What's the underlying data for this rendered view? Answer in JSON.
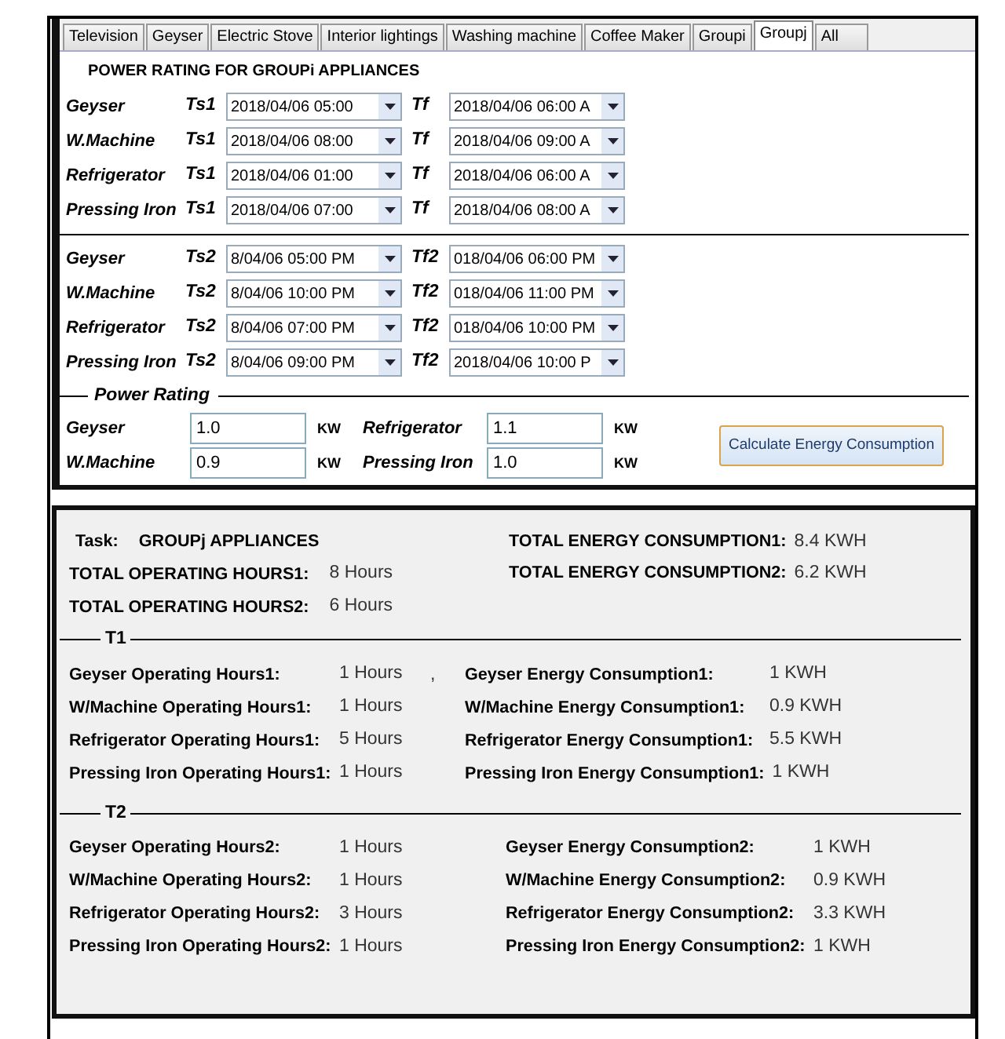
{
  "tabs": [
    {
      "label": "Television",
      "selected": false
    },
    {
      "label": "Geyser",
      "selected": false
    },
    {
      "label": "Electric Stove",
      "selected": false
    },
    {
      "label": "Interior lightings",
      "selected": false
    },
    {
      "label": "Washing machine",
      "selected": false
    },
    {
      "label": "Coffee Maker",
      "selected": false
    },
    {
      "label": "Groupi",
      "selected": false
    },
    {
      "label": "Groupj",
      "selected": true
    },
    {
      "label": "All",
      "selected": false
    }
  ],
  "section_title": "POWER RATING FOR GROUPi APPLIANCES",
  "schedule1": [
    {
      "appliance": "Geyser",
      "start_label": "Ts1",
      "start_value": "2018/04/06 05:00",
      "end_label": "Tf",
      "end_value": "2018/04/06 06:00 A"
    },
    {
      "appliance": "W.Machine",
      "start_label": "Ts1",
      "start_value": "2018/04/06 08:00",
      "end_label": "Tf",
      "end_value": "2018/04/06 09:00 A"
    },
    {
      "appliance": "Refrigerator",
      "start_label": "Ts1",
      "start_value": "2018/04/06 01:00",
      "end_label": "Tf",
      "end_value": "2018/04/06 06:00 A"
    },
    {
      "appliance": "Pressing Iron",
      "start_label": "Ts1",
      "start_value": "2018/04/06 07:00",
      "end_label": "Tf",
      "end_value": "2018/04/06 08:00 A"
    }
  ],
  "schedule2": [
    {
      "appliance": "Geyser",
      "start_label": "Ts2",
      "start_value": "8/04/06 05:00 PM",
      "end_label": "Tf2",
      "end_value": "018/04/06 06:00 PM"
    },
    {
      "appliance": "W.Machine",
      "start_label": "Ts2",
      "start_value": "8/04/06 10:00 PM",
      "end_label": "Tf2",
      "end_value": "018/04/06 11:00 PM"
    },
    {
      "appliance": "Refrigerator",
      "start_label": "Ts2",
      "start_value": "8/04/06 07:00 PM",
      "end_label": "Tf2",
      "end_value": "018/04/06 10:00 PM"
    },
    {
      "appliance": "Pressing Iron",
      "start_label": "Ts2",
      "start_value": "8/04/06 09:00 PM",
      "end_label": "Tf2",
      "end_value": "2018/04/06 10:00 P"
    }
  ],
  "power_rating": {
    "legend": "Power Rating",
    "items": [
      {
        "appliance": "Geyser",
        "value": "1.0",
        "unit": "KW"
      },
      {
        "appliance": "Refrigerator",
        "value": "1.1",
        "unit": "KW"
      },
      {
        "appliance": "W.Machine",
        "value": "0.9",
        "unit": "KW"
      },
      {
        "appliance": "Pressing Iron",
        "value": "1.0",
        "unit": "KW"
      }
    ],
    "button": "Calculate Energy Consumption"
  },
  "summary": {
    "task_label": "Task:",
    "task_value": "GROUPj APPLIANCES",
    "hours": [
      {
        "label": "TOTAL OPERATING HOURS1:",
        "value": "8 Hours"
      },
      {
        "label": "TOTAL OPERATING HOURS2:",
        "value": "6 Hours"
      }
    ],
    "energy": [
      {
        "label": "TOTAL ENERGY CONSUMPTION1:",
        "value": "8.4 KWH"
      },
      {
        "label": "TOTAL ENERGY CONSUMPTION2:",
        "value": "6.2 KWH"
      }
    ]
  },
  "periods": [
    {
      "legend": "T1",
      "mark": ",",
      "hours": [
        {
          "label": "Geyser Operating Hours1:",
          "value": "1 Hours"
        },
        {
          "label": "W/Machine Operating Hours1:",
          "value": "1 Hours"
        },
        {
          "label": "Refrigerator Operating Hours1:",
          "value": "5 Hours"
        },
        {
          "label": "Pressing Iron Operating Hours1:",
          "value": "1 Hours"
        }
      ],
      "energy": [
        {
          "label": "Geyser Energy Consumption1:",
          "value": "1 KWH"
        },
        {
          "label": "W/Machine Energy Consumption1:",
          "value": "0.9 KWH"
        },
        {
          "label": "Refrigerator Energy Consumption1:",
          "value": "5.5 KWH"
        },
        {
          "label": "Pressing Iron Energy Consumption1:",
          "value": "1 KWH"
        }
      ]
    },
    {
      "legend": "T2",
      "hours": [
        {
          "label": "Geyser Operating Hours2:",
          "value": "1 Hours"
        },
        {
          "label": "W/Machine Operating Hours2:",
          "value": "1 Hours"
        },
        {
          "label": "Refrigerator Operating Hours2:",
          "value": "3 Hours"
        },
        {
          "label": "Pressing Iron Operating Hours2:",
          "value": "1 Hours"
        }
      ],
      "energy": [
        {
          "label": "Geyser Energy Consumption2:",
          "value": "1 KWH"
        },
        {
          "label": "W/Machine Energy Consumption2:",
          "value": "0.9 KWH"
        },
        {
          "label": "Refrigerator Energy Consumption2:",
          "value": "3.3 KWH"
        },
        {
          "label": "Pressing Iron Energy Consumption2:",
          "value": "1 KWH"
        }
      ]
    }
  ]
}
